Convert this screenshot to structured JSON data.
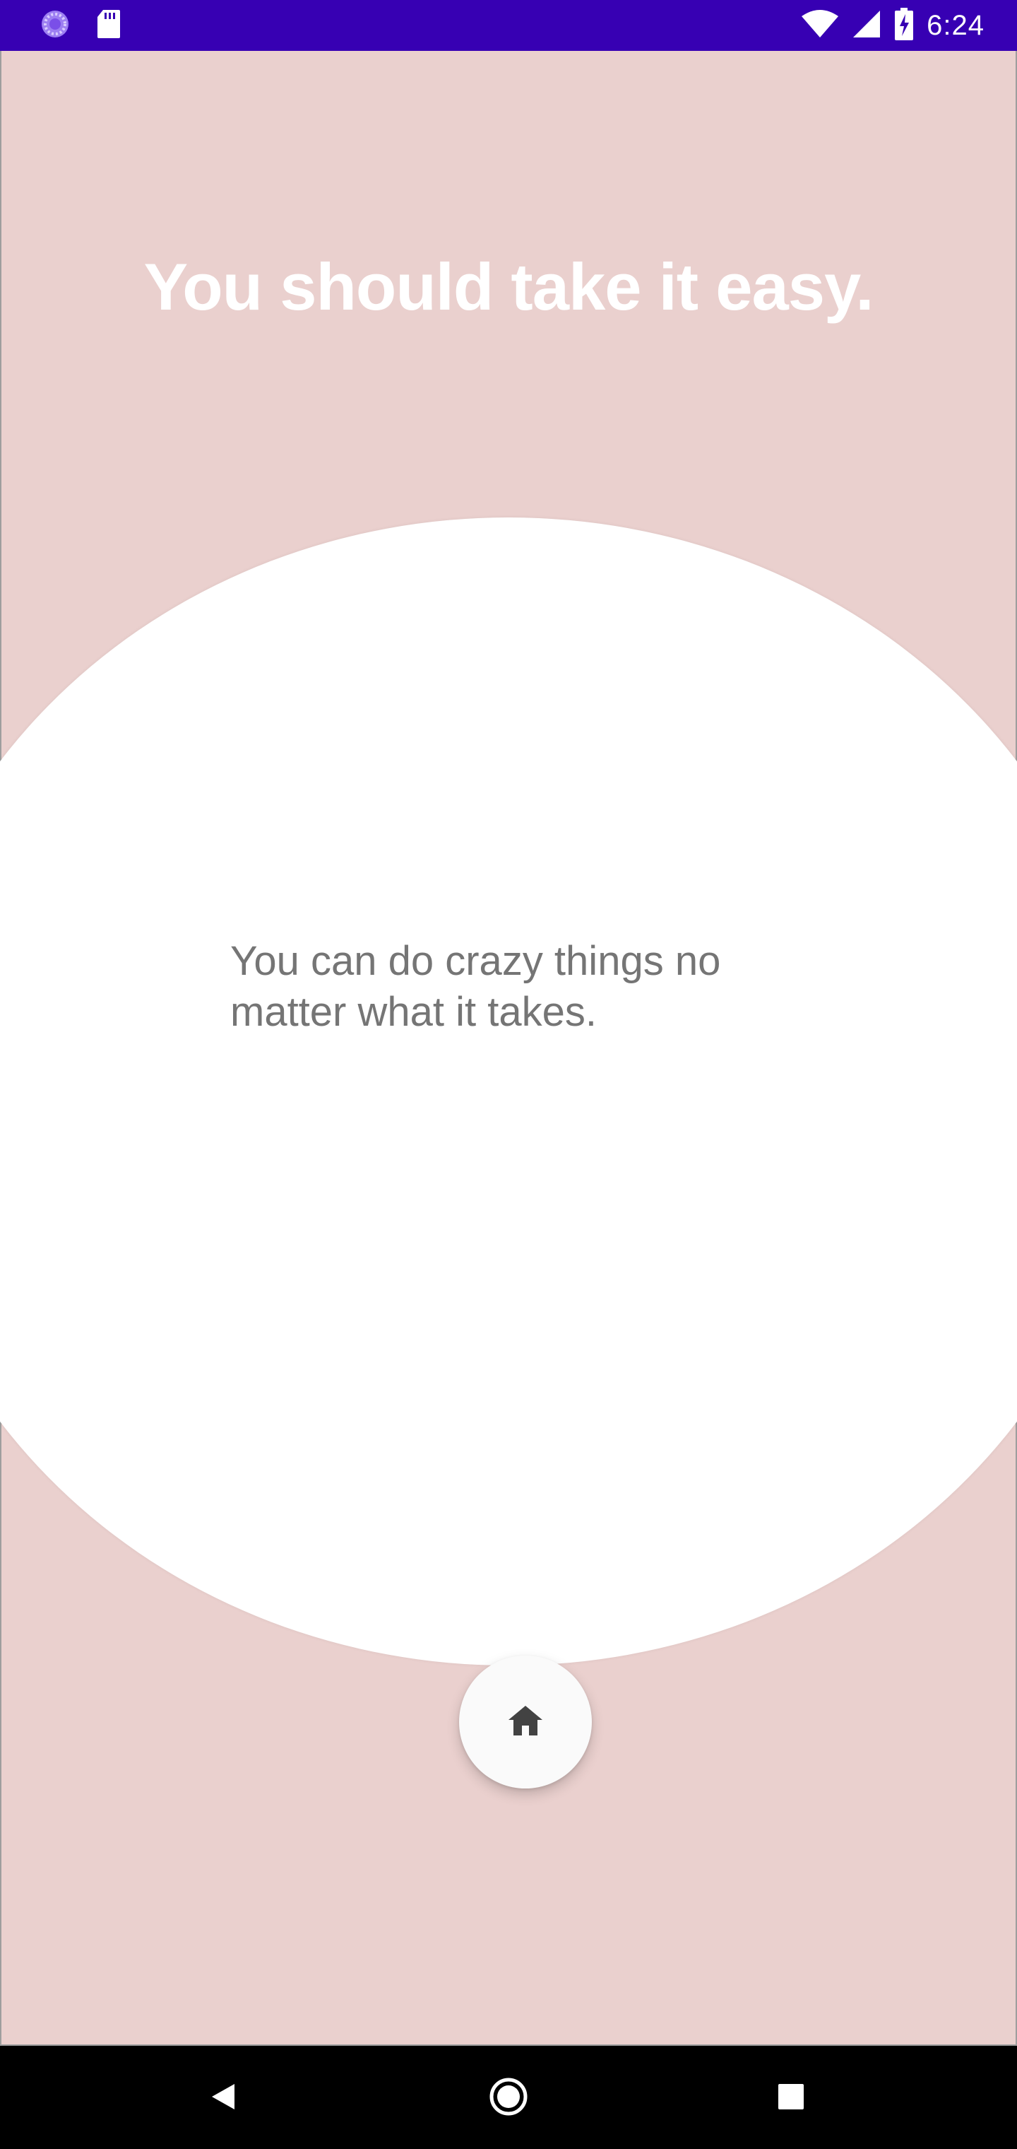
{
  "status_bar": {
    "time": "6:24",
    "left_icons": [
      "loading-spinner-icon",
      "sd-card-icon"
    ],
    "right_icons": [
      "wifi-icon",
      "cellular-signal-icon",
      "battery-charging-icon"
    ],
    "background_color": "#3700b3"
  },
  "main": {
    "headline": "You should take it easy.",
    "message": "You can do crazy things no matter what it takes.",
    "background_color": "#ead0ce",
    "home_button_icon": "home-icon"
  },
  "nav_bar": {
    "buttons": [
      "back-icon",
      "home-circle-icon",
      "recents-icon"
    ]
  }
}
